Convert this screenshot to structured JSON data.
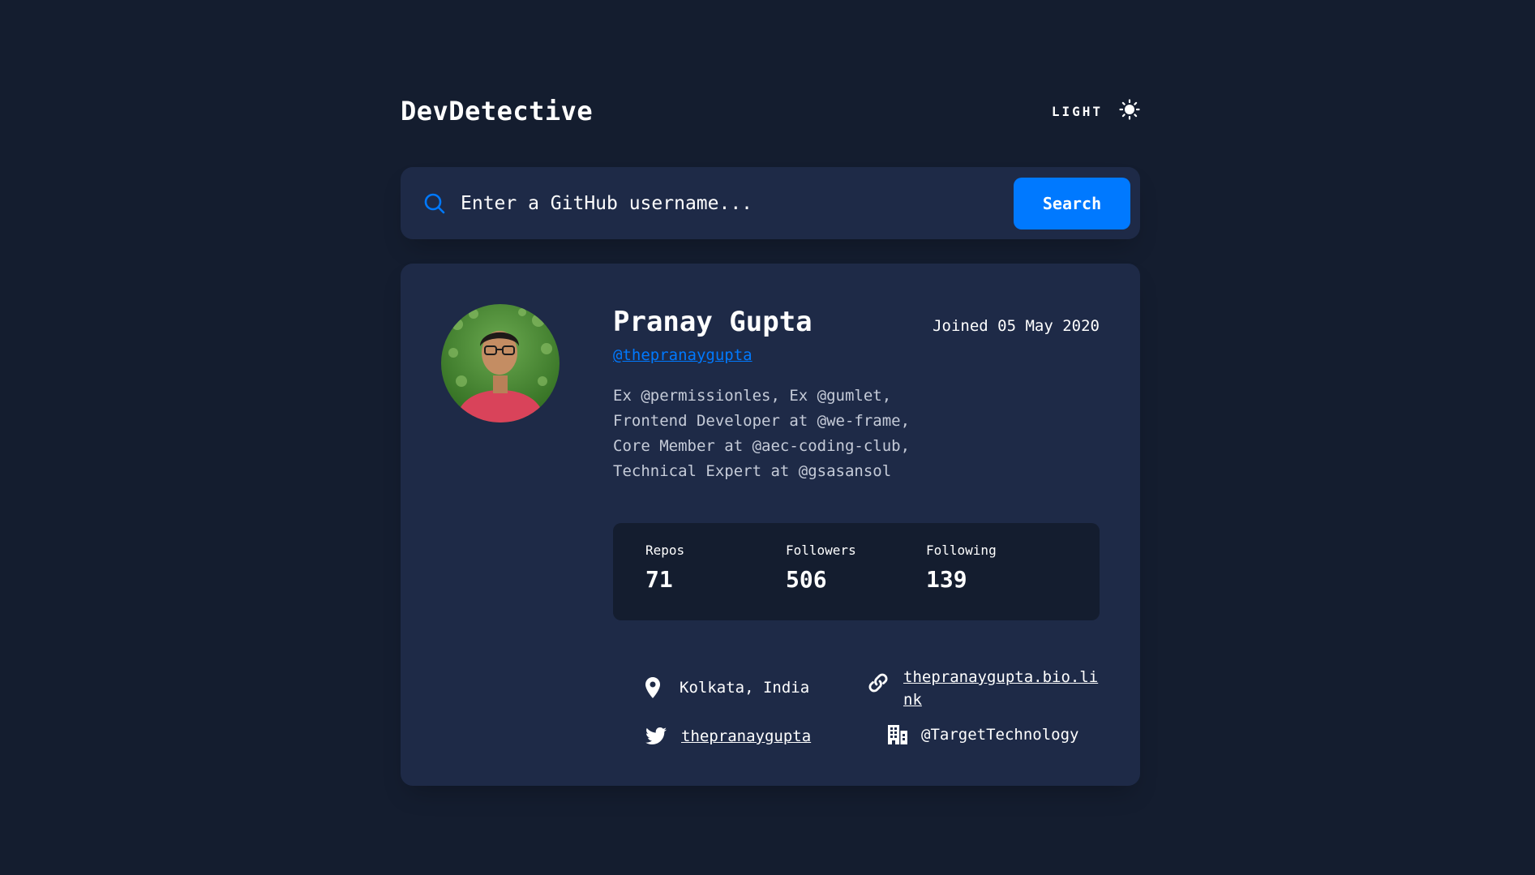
{
  "app": {
    "title": "DevDetective",
    "theme_label": "LIGHT",
    "theme_icon": "sun-icon"
  },
  "search": {
    "placeholder": "Enter a GitHub username...",
    "value": "",
    "button_label": "Search",
    "icon": "search-icon"
  },
  "colors": {
    "background": "#141d2f",
    "card": "#1e2a47",
    "accent": "#0079ff"
  },
  "profile": {
    "name": "Pranay Gupta",
    "joined": "Joined 05 May 2020",
    "login": "@thepranaygupta",
    "bio_lines": [
      "Ex @permissionles, Ex @gumlet,",
      "Frontend Developer at @we-frame,",
      "Core Member at @aec-coding-club,",
      "Technical Expert at @gsasansol"
    ]
  },
  "stats": [
    {
      "label": "Repos",
      "value": "71"
    },
    {
      "label": "Followers",
      "value": "506"
    },
    {
      "label": "Following",
      "value": "139"
    }
  ],
  "links": {
    "location": {
      "icon": "location-pin-icon",
      "text": "Kolkata, India"
    },
    "website": {
      "icon": "link-icon",
      "text_line1": "thepranaygupta.bio.li",
      "text_line2": "nk"
    },
    "twitter": {
      "icon": "twitter-icon",
      "text": "thepranaygupta"
    },
    "company": {
      "icon": "building-icon",
      "text": "@TargetTechnology"
    }
  }
}
